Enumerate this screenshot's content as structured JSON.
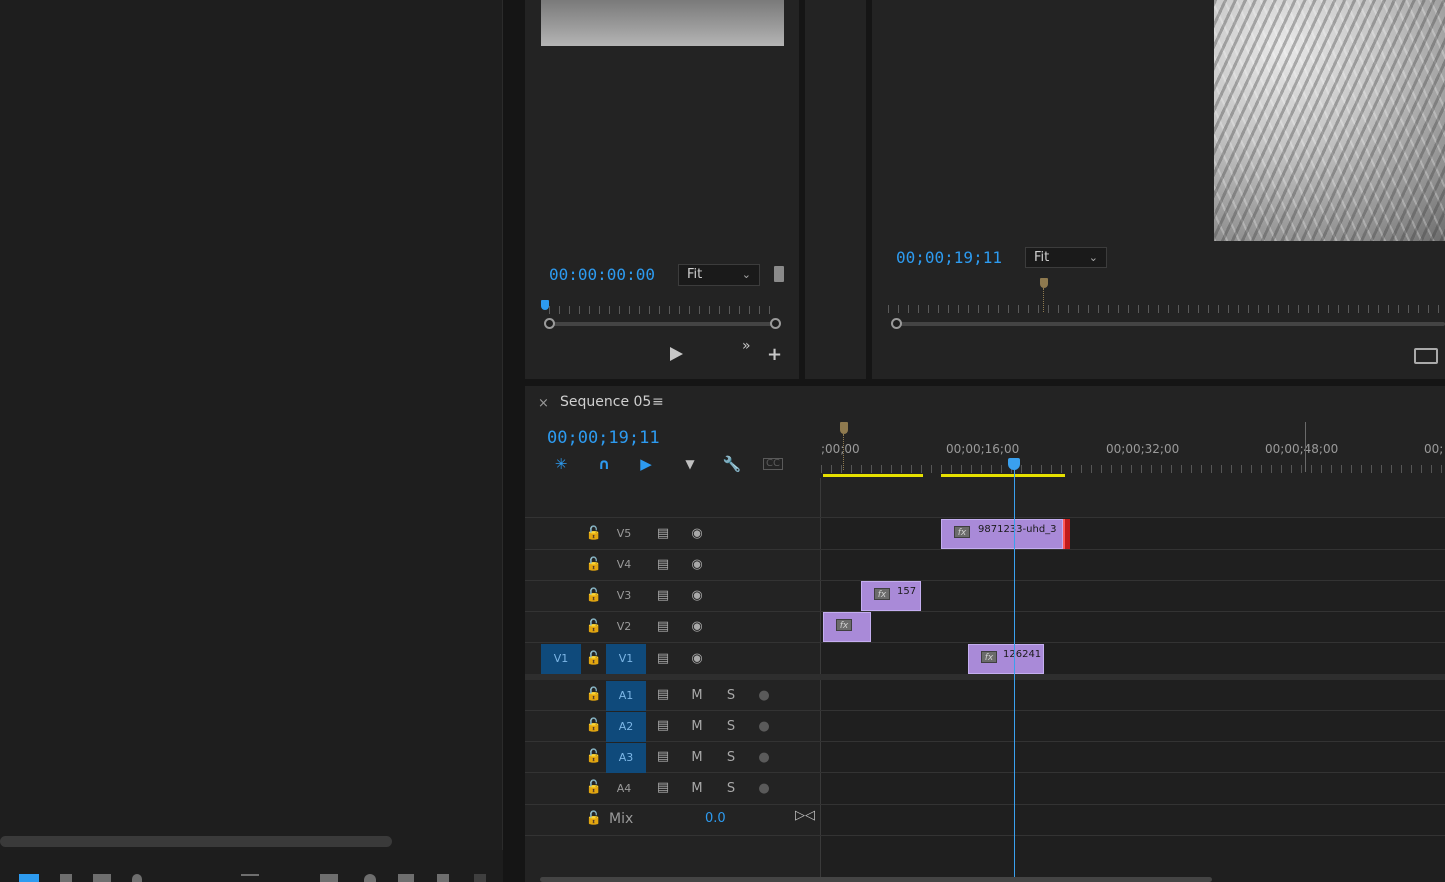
{
  "source_monitor": {
    "timecode": "00:00:00:00",
    "fit_label": "Fit"
  },
  "program_monitor": {
    "timecode": "00;00;19;11",
    "fit_label": "Fit"
  },
  "timeline": {
    "close_label": "×",
    "sequence_name": "Sequence 05",
    "menu_glyph": "≡",
    "timecode": "00;00;19;11",
    "ruler_labels": [
      ";00;00",
      "00;00;16;00",
      "00;00;32;00",
      "00;00;48;00",
      "00;"
    ],
    "video_tracks": [
      {
        "name": "V5",
        "source": ""
      },
      {
        "name": "V4",
        "source": ""
      },
      {
        "name": "V3",
        "source": ""
      },
      {
        "name": "V2",
        "source": ""
      },
      {
        "name": "V1",
        "source": "V1"
      }
    ],
    "audio_tracks": [
      {
        "name": "A1",
        "mute": "M",
        "solo": "S"
      },
      {
        "name": "A2",
        "mute": "M",
        "solo": "S"
      },
      {
        "name": "A3",
        "mute": "M",
        "solo": "S"
      },
      {
        "name": "A4",
        "mute": "M",
        "solo": "S"
      }
    ],
    "mix": {
      "label": "Mix",
      "value": "0.0"
    },
    "clips": [
      {
        "name": "9871233-uhd_3",
        "fx": "fx"
      },
      {
        "name": "157",
        "fx": "fx"
      },
      {
        "name": "",
        "fx": "fx"
      },
      {
        "name": "126241",
        "fx": "fx"
      }
    ]
  },
  "colors": {
    "timecode_blue": "#2d9bf0",
    "clip_purple": "#a98ad8",
    "selected_track": "#0f4a7b",
    "in_out_yellow": "#e6e000"
  }
}
